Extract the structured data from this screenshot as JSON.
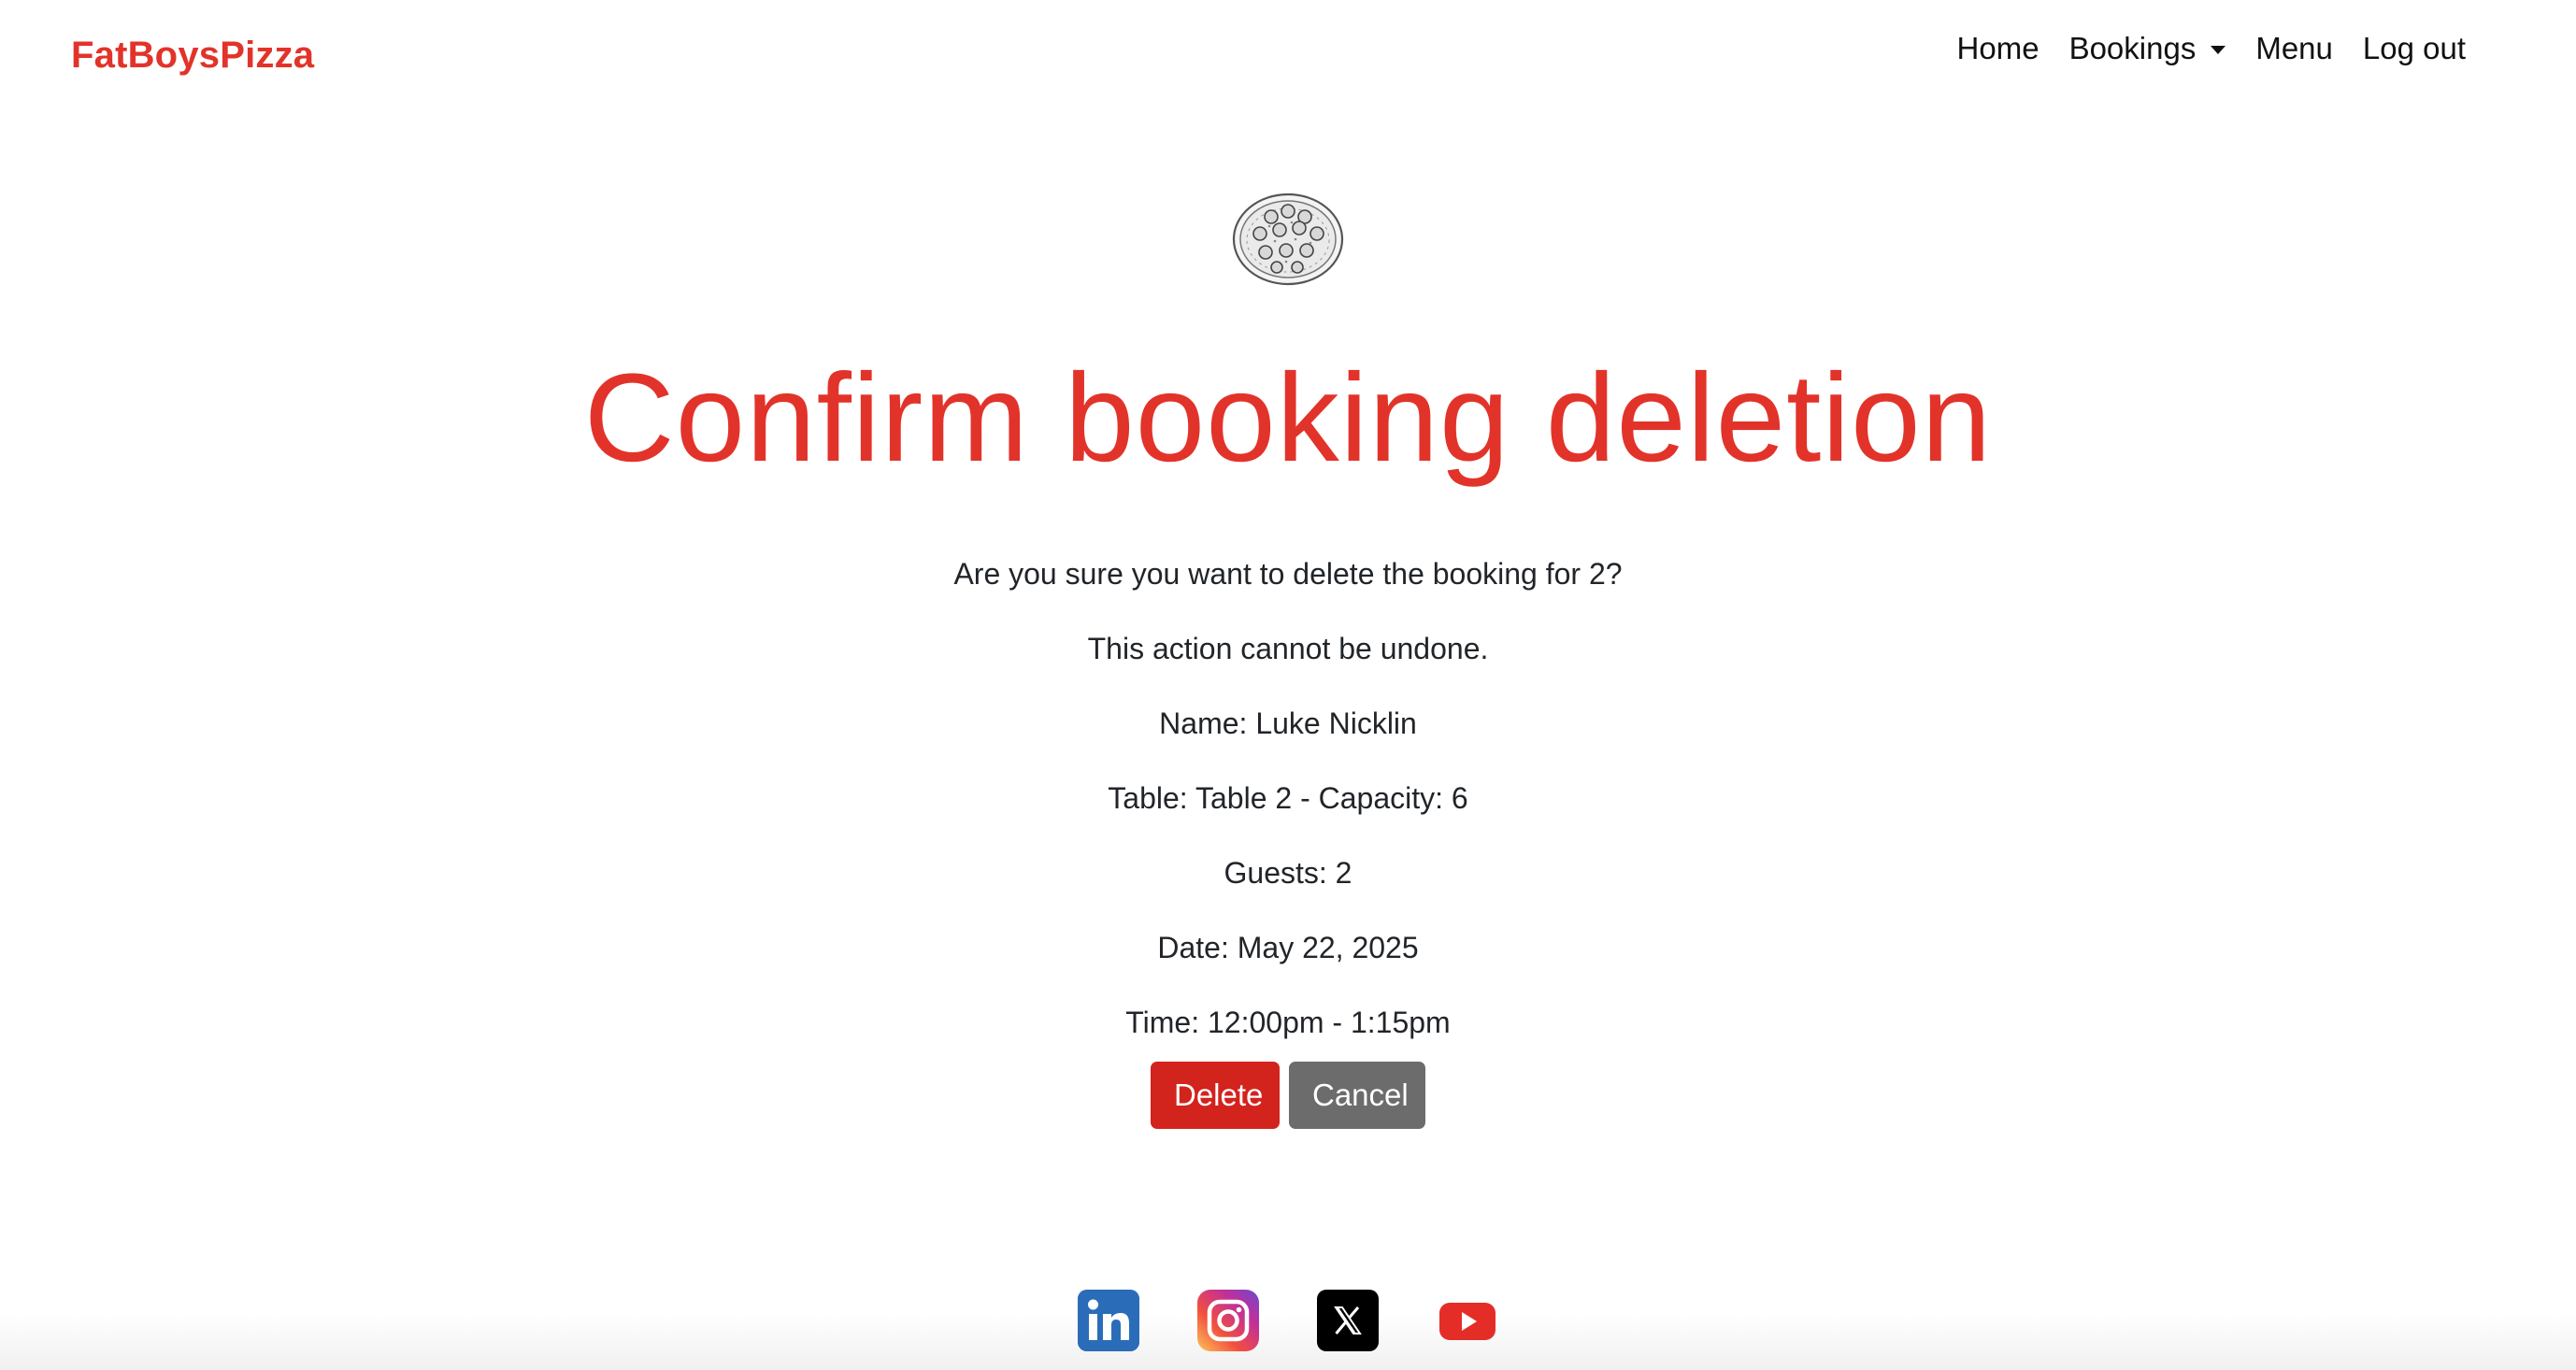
{
  "navbar": {
    "brand": "FatBoysPizza",
    "links": {
      "home": "Home",
      "bookings": "Bookings",
      "menu": "Menu",
      "logout": "Log out"
    }
  },
  "main": {
    "logo_icon": "pizza-icon",
    "title": "Confirm booking deletion",
    "question": "Are you sure you want to delete the booking for 2?",
    "warning": "This action cannot be undone.",
    "name": "Name: Luke Nicklin",
    "table": "Table: Table 2 - Capacity: 6",
    "guests": "Guests: 2",
    "date": "Date: May 22, 2025",
    "time": "Time: 12:00pm - 1:15pm",
    "delete_label": "Delete",
    "cancel_label": "Cancel"
  },
  "footer": {
    "social": [
      "linkedin-icon",
      "instagram-icon",
      "x-icon",
      "youtube-icon"
    ]
  },
  "colors": {
    "brand": "#e2332a",
    "delete": "#d3231d",
    "cancel": "#6c6c6c"
  }
}
